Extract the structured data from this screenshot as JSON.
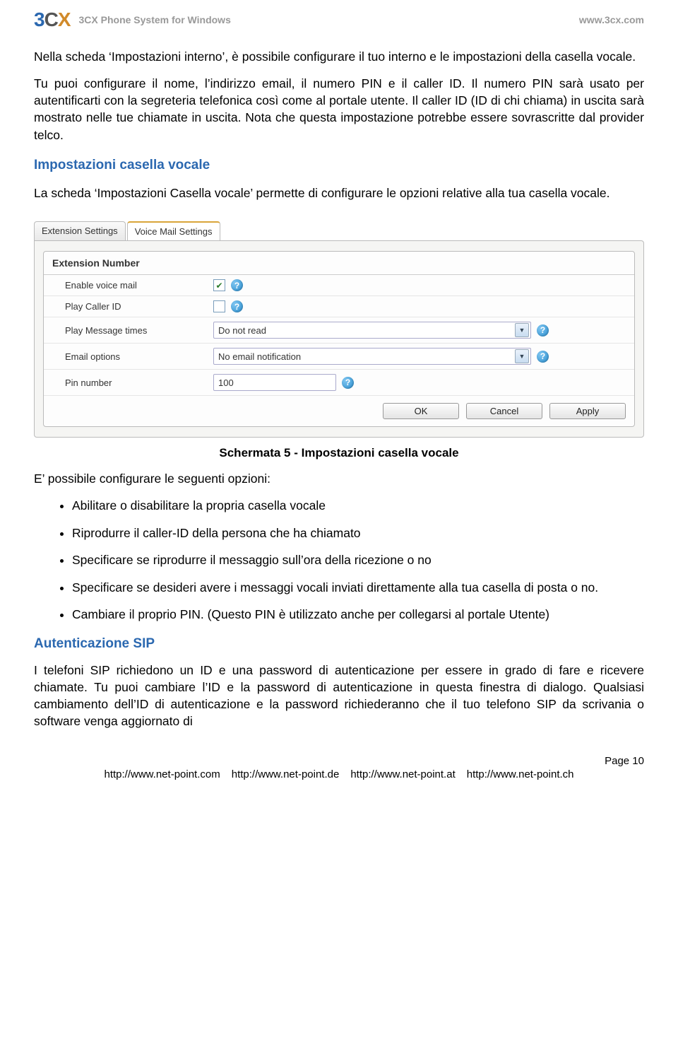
{
  "header": {
    "product": "3CX Phone System for Windows",
    "site": "www.3cx.com",
    "logo": {
      "p1": "3",
      "p2": "C",
      "p3": "X"
    }
  },
  "body": {
    "p1": "Nella scheda ‘Impostazioni interno’, è possibile configurare il tuo interno e le impostazioni della casella vocale.",
    "p2": "Tu puoi configurare il nome, l’indirizzo email, il numero PIN e il caller ID. Il numero PIN sarà usato per autentificarti con la segreteria telefonica così come al portale utente. Il caller ID (ID di chi chiama) in uscita sarà mostrato nelle tue chiamate in uscita. Nota che questa impostazione potrebbe essere sovrascritte dal provider telco.",
    "h_voicemail": "Impostazioni casella vocale",
    "p3": "La scheda ‘Impostazioni Casella vocale’ permette di configurare le opzioni relative alla tua casella vocale.",
    "caption": "Schermata 5 - Impostazioni casella vocale",
    "p4": "E’ possibile configurare le seguenti opzioni:",
    "bullets": [
      "Abilitare o disabilitare la propria casella vocale",
      "Riprodurre il caller-ID della persona che ha chiamato",
      "Specificare se riprodurre il messaggio sull’ora della ricezione o no",
      "Specificare se desideri avere i messaggi vocali inviati direttamente alla tua casella di posta o no.",
      "Cambiare il proprio PIN. (Questo PIN è utilizzato anche per collegarsi al portale Utente)"
    ],
    "h_sip": "Autenticazione SIP",
    "p5": "I telefoni SIP richiedono un ID e una password di autenticazione per essere in grado di fare e ricevere chiamate. Tu puoi cambiare l’ID e la password di autenticazione in questa finestra di dialogo. Qualsiasi cambiamento dell’ID di autenticazione e la password richiederanno che il tuo telefono SIP da scrivania o software venga aggiornato di"
  },
  "screenshot": {
    "tabs": {
      "t1": "Extension Settings",
      "t2": "Voice Mail Settings"
    },
    "section_title": "Extension Number",
    "rows": {
      "enable": "Enable voice mail",
      "play_caller": "Play Caller ID",
      "play_times": "Play Message times",
      "email": "Email options",
      "pin": "Pin number"
    },
    "values": {
      "play_times": "Do not read",
      "email": "No email notification",
      "pin": "100"
    },
    "buttons": {
      "ok": "OK",
      "cancel": "Cancel",
      "apply": "Apply"
    },
    "help": "?"
  },
  "footer": {
    "page": "Page 10",
    "links": [
      "http://www.net-point.com",
      "http://www.net-point.de",
      "http://www.net-point.at",
      "http://www.net-point.ch"
    ]
  }
}
